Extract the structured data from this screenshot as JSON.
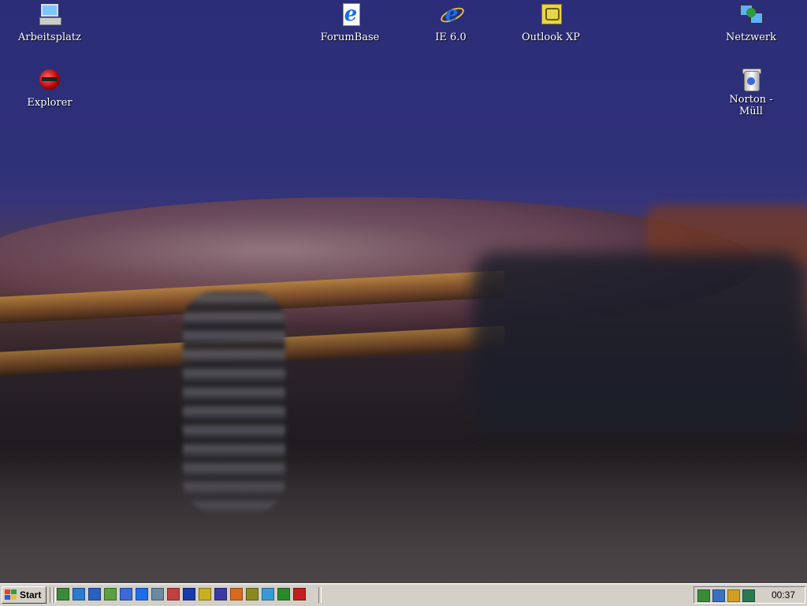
{
  "desktop": {
    "icons": [
      {
        "label": "Arbeitsplatz",
        "icon": "my-computer-icon"
      },
      {
        "label": "ForumBase",
        "icon": "internet-page-icon"
      },
      {
        "label": "IE 6.0",
        "icon": "internet-explorer-icon"
      },
      {
        "label": "Outlook XP",
        "icon": "outlook-icon"
      },
      {
        "label": "Netzwerk",
        "icon": "network-icon"
      },
      {
        "label": "Explorer",
        "icon": "explorer-icon"
      },
      {
        "label": "Norton - Müll",
        "icon": "recycle-bin-icon"
      }
    ]
  },
  "taskbar": {
    "start_label": "Start",
    "quick_launch": [
      {
        "icon": "show-desktop-icon",
        "color": "#3a8a3a"
      },
      {
        "icon": "globe-icon",
        "color": "#2a7ad0"
      },
      {
        "icon": "outlook-express-icon",
        "color": "#2a60c0"
      },
      {
        "icon": "shield-icon",
        "color": "#5aa040"
      },
      {
        "icon": "notepad-icon",
        "color": "#3a6ad8"
      },
      {
        "icon": "internet-explorer-icon",
        "color": "#1c6ee8"
      },
      {
        "icon": "network-tool-icon",
        "color": "#6a8aa0"
      },
      {
        "icon": "paint-icon",
        "color": "#c04040"
      },
      {
        "icon": "word-icon",
        "color": "#1a3aa8"
      },
      {
        "icon": "outlook-icon",
        "color": "#c8b020"
      },
      {
        "icon": "media-icon",
        "color": "#3a3aa0"
      },
      {
        "icon": "tool-icon",
        "color": "#d86a20"
      },
      {
        "icon": "search-icon",
        "color": "#8a8a20"
      },
      {
        "icon": "messenger-icon",
        "color": "#3a9ad8"
      },
      {
        "icon": "clover-icon",
        "color": "#2a8a2a"
      },
      {
        "icon": "game-icon",
        "color": "#c02020"
      }
    ],
    "tray": [
      {
        "icon": "update-icon",
        "color": "#3a8a3a"
      },
      {
        "icon": "monitor-icon",
        "color": "#3a70c0"
      },
      {
        "icon": "volume-icon",
        "color": "#d0a020"
      },
      {
        "icon": "network-globe-icon",
        "color": "#2a7a50"
      }
    ],
    "clock": "00:37"
  }
}
